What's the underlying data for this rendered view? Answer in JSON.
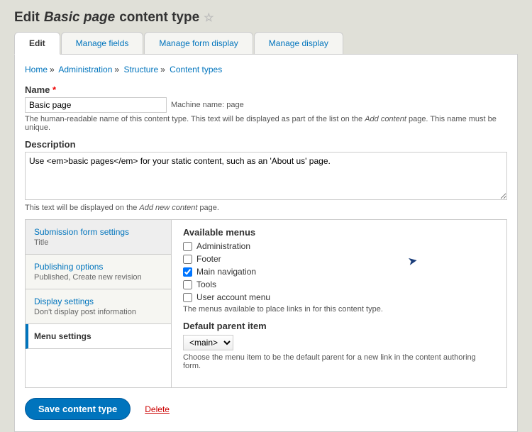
{
  "title": {
    "prefix": "Edit",
    "em": "Basic page",
    "suffix": "content type"
  },
  "tabs": [
    "Edit",
    "Manage fields",
    "Manage form display",
    "Manage display"
  ],
  "breadcrumb": [
    "Home",
    "Administration",
    "Structure",
    "Content types"
  ],
  "name": {
    "label": "Name",
    "value": "Basic page",
    "machine_label": "Machine name:",
    "machine_value": "page",
    "help_a": "The human-readable name of this content type. This text will be displayed as part of the list on the ",
    "help_em": "Add content",
    "help_b": " page. This name must be unique."
  },
  "description": {
    "label": "Description",
    "value": "Use <em>basic pages</em> for your static content, such as an 'About us' page.",
    "help_a": "This text will be displayed on the ",
    "help_em": "Add new content",
    "help_b": " page."
  },
  "vtabs": [
    {
      "title": "Submission form settings",
      "summary": "Title"
    },
    {
      "title": "Publishing options",
      "summary": "Published, Create new revision"
    },
    {
      "title": "Display settings",
      "summary": "Don't display post information"
    },
    {
      "title": "Menu settings",
      "summary": ""
    }
  ],
  "menus": {
    "label": "Available menus",
    "items": [
      {
        "label": "Administration",
        "checked": false
      },
      {
        "label": "Footer",
        "checked": false
      },
      {
        "label": "Main navigation",
        "checked": true
      },
      {
        "label": "Tools",
        "checked": false
      },
      {
        "label": "User account menu",
        "checked": false
      }
    ],
    "help": "The menus available to place links in for this content type.",
    "default_label": "Default parent item",
    "default_value": "<main>",
    "default_help": "Choose the menu item to be the default parent for a new link in the content authoring form."
  },
  "actions": {
    "save": "Save content type",
    "delete": "Delete"
  }
}
